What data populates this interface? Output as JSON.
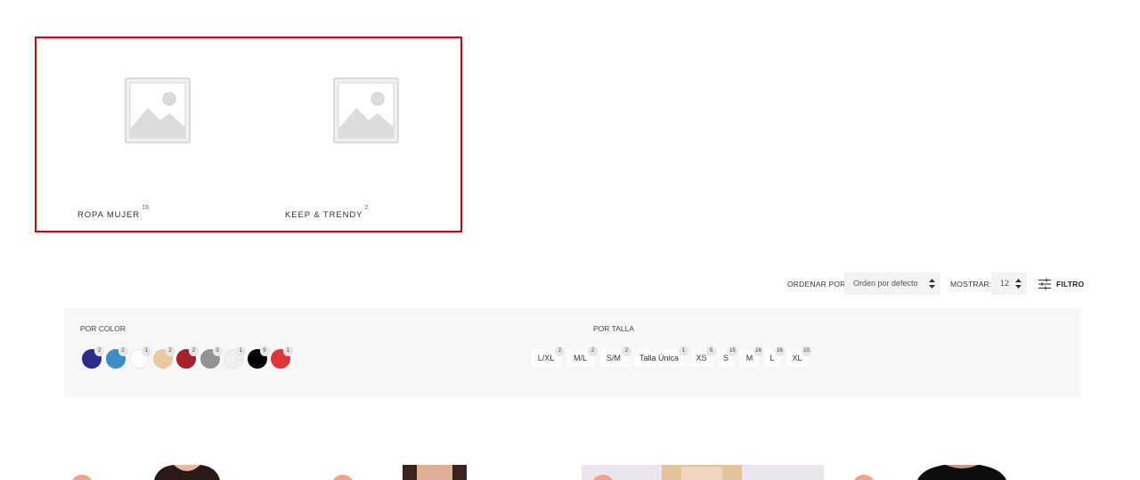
{
  "categories": [
    {
      "label": "ROPA MUJER",
      "count": "19",
      "thumb_icon": "image-placeholder-icon"
    },
    {
      "label": "KEEP & TRENDY",
      "count": "2",
      "thumb_icon": "image-placeholder-icon"
    }
  ],
  "toolbar": {
    "order_label": "ORDENAR POR:",
    "order_value": "Orden por defecto",
    "show_label": "MOSTRAR:",
    "show_value": "12",
    "filter_label": "FILTRO",
    "filter_icon": "sliders-icon",
    "select_icon": "sort-arrows-icon"
  },
  "filters": {
    "color_title": "POR COLOR",
    "colors": [
      {
        "hex": "#2b2d86",
        "count": "2"
      },
      {
        "hex": "#3d8dc7",
        "count": "2"
      },
      {
        "hex": "#ffffff",
        "count": "1"
      },
      {
        "hex": "#e8c9a0",
        "count": "2"
      },
      {
        "hex": "#a81f2d",
        "count": "2"
      },
      {
        "hex": "#949494",
        "count": "3"
      },
      {
        "hex": "#efefef",
        "count": "1"
      },
      {
        "hex": "#050505",
        "count": "5"
      },
      {
        "hex": "#e0343b",
        "count": "1"
      }
    ],
    "size_title": "POR TALLA",
    "sizes": [
      {
        "label": "L/XL",
        "count": "2"
      },
      {
        "label": "M/L",
        "count": "2"
      },
      {
        "label": "S/M",
        "count": "2"
      },
      {
        "label": "Talla Única",
        "count": "1"
      },
      {
        "label": "XS",
        "count": "5"
      },
      {
        "label": "S",
        "count": "15"
      },
      {
        "label": "M",
        "count": "16"
      },
      {
        "label": "L",
        "count": "16"
      },
      {
        "label": "XL",
        "count": "10"
      }
    ]
  },
  "colors": {
    "highlight_border": "#e00000",
    "panel_bg": "#f7f7f7",
    "sale_badge": "#f0a48a"
  }
}
